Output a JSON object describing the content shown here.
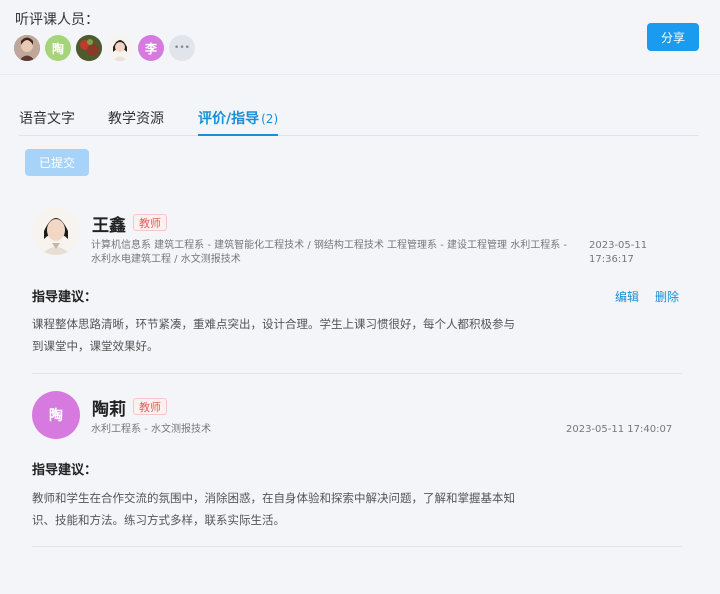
{
  "header": {
    "label": "听评课人员：",
    "share_label": "分享",
    "avatars": [
      {
        "type": "photo",
        "color": "#7a5a4a"
      },
      {
        "type": "text",
        "text": "陶",
        "color": "#a6d47a"
      },
      {
        "type": "photo",
        "color": "#5a6a3a"
      },
      {
        "type": "photo",
        "color": "#e9dccd"
      },
      {
        "type": "text",
        "text": "李",
        "color": "#d77ae0"
      },
      {
        "type": "more",
        "text": "•••",
        "color": "#e1e4ea"
      }
    ]
  },
  "tabs": [
    {
      "label": "语音文字",
      "active": false
    },
    {
      "label": "教学资源",
      "active": false
    },
    {
      "label": "评价/指导",
      "count": "(2)",
      "active": true
    }
  ],
  "submitted_label": "已提交",
  "reviews": [
    {
      "name": "王鑫",
      "role": "教师",
      "avatar": {
        "type": "photo"
      },
      "dept_line1": "计算机信息系 建筑工程系 - 建筑智能化工程技术 / 钢结构工程技术 工程管理系 - 建设工程管理 水利工程系 -",
      "dept_line2": "水利水电建筑工程 / 水文测报技术",
      "time_line1": "2023-05-11",
      "time_line2": "17:36:17",
      "guide_label": "指导建议：",
      "edit_label": "编辑",
      "delete_label": "删除",
      "content_line1": "课程整体思路清晰，环节紧凑，重难点突出，设计合理。学生上课习惯很好，每个人都积极参与",
      "content_line2": "到课堂中，课堂效果好。"
    },
    {
      "name": "陶莉",
      "role": "教师",
      "avatar": {
        "type": "text",
        "text": "陶",
        "color": "#d77ae0"
      },
      "dept_line1": "水利工程系 - 水文测报技术",
      "time_line1": "2023-05-11 17:40:07",
      "guide_label": "指导建议：",
      "content_line1": "教师和学生在合作交流的氛围中，消除困惑，在自身体验和探索中解决问题，了解和掌握基本知",
      "content_line2": "识、技能和方法。练习方式多样，联系实际生活。"
    }
  ]
}
